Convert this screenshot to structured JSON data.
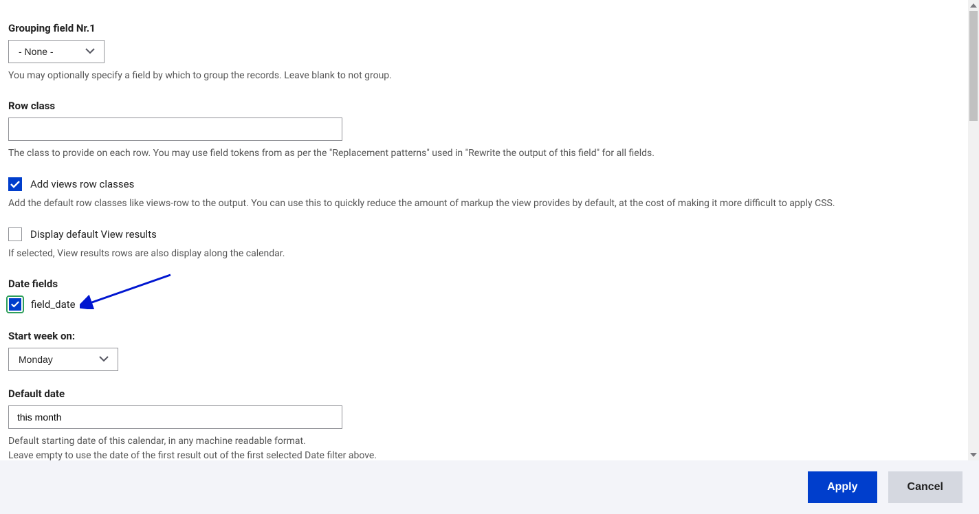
{
  "grouping_field": {
    "label": "Grouping field Nr.1",
    "value": "- None -",
    "description": "You may optionally specify a field by which to group the records. Leave blank to not group."
  },
  "row_class": {
    "label": "Row class",
    "value": "",
    "description": "The class to provide on each row. You may use field tokens from as per the \"Replacement patterns\" used in \"Rewrite the output of this field\" for all fields."
  },
  "add_views_row_classes": {
    "label": "Add views row classes",
    "checked": true,
    "description": "Add the default row classes like views-row to the output. You can use this to quickly reduce the amount of markup the view provides by default, at the cost of making it more difficult to apply CSS."
  },
  "display_default_results": {
    "label": "Display default View results",
    "checked": false,
    "description": "If selected, View results rows are also display along the calendar."
  },
  "date_fields": {
    "label": "Date fields",
    "options": [
      {
        "label": "field_date",
        "checked": true
      }
    ]
  },
  "start_week_on": {
    "label": "Start week on:",
    "value": "Monday"
  },
  "default_date": {
    "label": "Default date",
    "value": "this month",
    "description_line1": "Default starting date of this calendar, in any machine readable format.",
    "description_line2": "Leave empty to use the date of the first result out of the first selected Date filter above."
  },
  "footer": {
    "apply": "Apply",
    "cancel": "Cancel"
  }
}
